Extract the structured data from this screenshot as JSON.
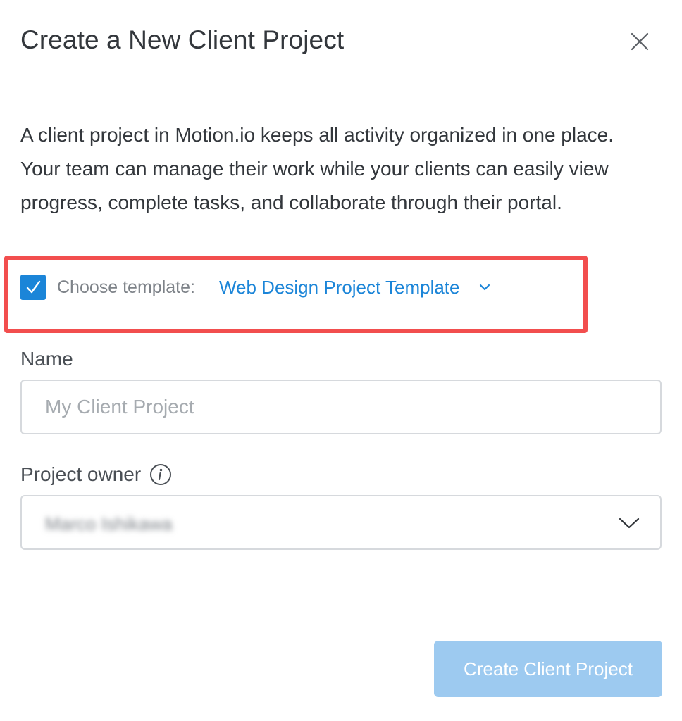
{
  "dialog": {
    "title": "Create a New Client Project",
    "description": "A client project in Motion.io keeps all activity organized in one place. Your team can manage their work while your clients can easily view progress, complete tasks, and collaborate through their portal."
  },
  "template": {
    "checked": true,
    "label": "Choose template:",
    "value": "Web Design Project Template"
  },
  "name_field": {
    "label": "Name",
    "placeholder": "My Client Project",
    "value": ""
  },
  "owner_field": {
    "label": "Project owner",
    "value": "Marco Ishikawa"
  },
  "submit_button": {
    "label": "Create Client Project"
  },
  "colors": {
    "accent": "#1b85d8",
    "highlight_border": "#f24e4e",
    "disabled_button": "#9dcaf0"
  },
  "icons": [
    "close-icon",
    "checkmark-icon",
    "chevron-down-icon",
    "info-icon"
  ]
}
